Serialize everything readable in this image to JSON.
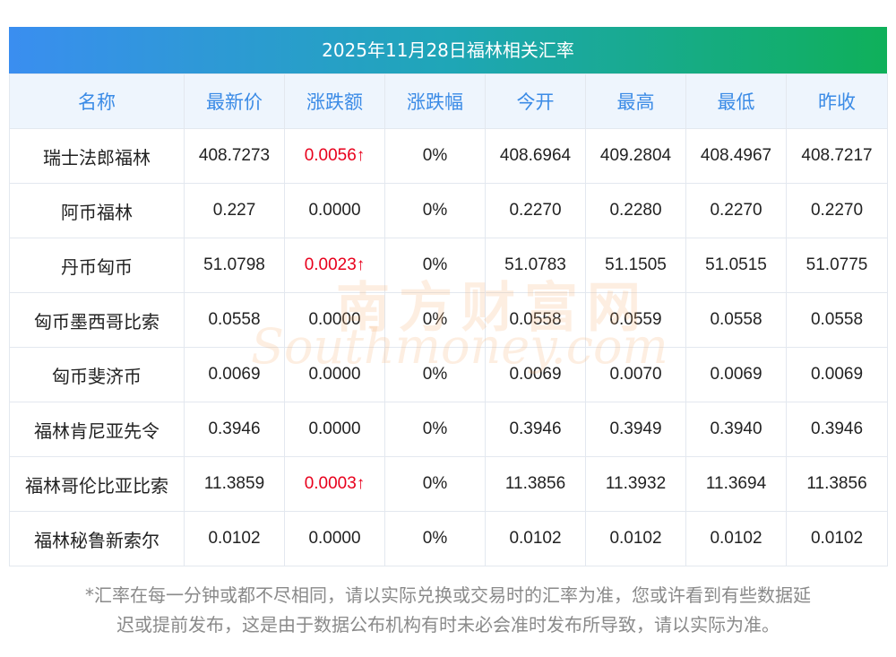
{
  "title": "2025年11月28日福林相关汇率",
  "headers": [
    "名称",
    "最新价",
    "涨跌额",
    "涨跌幅",
    "今开",
    "最高",
    "最低",
    "昨收"
  ],
  "rows": [
    {
      "name": "瑞士法郎福林",
      "latest": "408.7273",
      "change": "0.0056↑",
      "change_pct": "0%",
      "open": "408.6964",
      "high": "409.2804",
      "low": "408.4967",
      "prev": "408.7217"
    },
    {
      "name": "阿币福林",
      "latest": "0.227",
      "change": "0.0000",
      "change_pct": "0%",
      "open": "0.2270",
      "high": "0.2280",
      "low": "0.2270",
      "prev": "0.2270"
    },
    {
      "name": "丹币匈币",
      "latest": "51.0798",
      "change": "0.0023↑",
      "change_pct": "0%",
      "open": "51.0783",
      "high": "51.1505",
      "low": "51.0515",
      "prev": "51.0775"
    },
    {
      "name": "匈币墨西哥比索",
      "latest": "0.0558",
      "change": "0.0000",
      "change_pct": "0%",
      "open": "0.0558",
      "high": "0.0559",
      "low": "0.0558",
      "prev": "0.0558"
    },
    {
      "name": "匈币斐济币",
      "latest": "0.0069",
      "change": "0.0000",
      "change_pct": "0%",
      "open": "0.0069",
      "high": "0.0070",
      "low": "0.0069",
      "prev": "0.0069"
    },
    {
      "name": "福林肯尼亚先令",
      "latest": "0.3946",
      "change": "0.0000",
      "change_pct": "0%",
      "open": "0.3946",
      "high": "0.3949",
      "low": "0.3940",
      "prev": "0.3946"
    },
    {
      "name": "福林哥伦比亚比索",
      "latest": "11.3859",
      "change": "0.0003↑",
      "change_pct": "0%",
      "open": "11.3856",
      "high": "11.3932",
      "low": "11.3694",
      "prev": "11.3856"
    },
    {
      "name": "福林秘鲁新索尔",
      "latest": "0.0102",
      "change": "0.0000",
      "change_pct": "0%",
      "open": "0.0102",
      "high": "0.0102",
      "low": "0.0102",
      "prev": "0.0102"
    }
  ],
  "footnote_line1": "*汇率在每一分钟或都不尽相同，请以实际兑换或交易时的汇率为准，您或许看到有些数据延",
  "footnote_line2": "迟或提前发布，这是由于数据公布机构有时未必会准时发布所导致，请以实际为准。",
  "watermark_cn": "南方财富网",
  "watermark_en": "Southmoney.com",
  "colors": {
    "header_text": "#3b8be6",
    "up": "#e8001c",
    "title_from": "#3a8ef0",
    "title_to": "#0fb05a"
  }
}
